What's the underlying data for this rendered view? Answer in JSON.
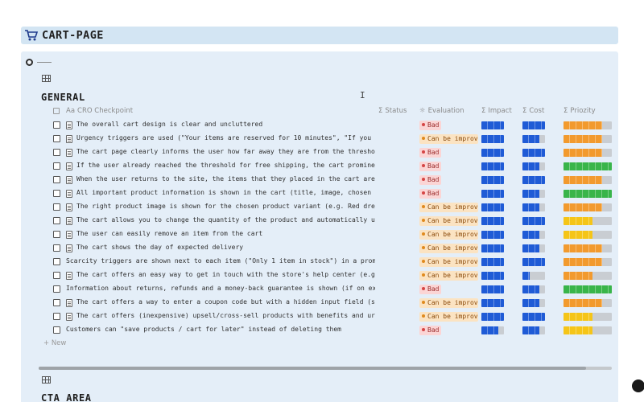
{
  "page": {
    "title": "CART-PAGE",
    "icon": "cart-icon"
  },
  "sections": {
    "general": {
      "title": "GENERAL"
    },
    "cta": {
      "title": "CTA AREA"
    }
  },
  "table": {
    "columns": [
      {
        "key": "checkpoint",
        "symbol": "Aa",
        "label": "CRO Checkpoint"
      },
      {
        "key": "status",
        "symbol": "Σ",
        "label": "Status"
      },
      {
        "key": "evaluation",
        "symbol": "☼",
        "label": "Evaluation"
      },
      {
        "key": "impact",
        "symbol": "Σ",
        "label": "Impact"
      },
      {
        "key": "cost",
        "symbol": "Σ",
        "label": "Cost"
      },
      {
        "key": "priority",
        "symbol": "Σ",
        "label": "Priozity"
      }
    ],
    "new_label": "+ New",
    "rows": [
      {
        "doc": true,
        "text": "The overall cart design is clear and uncluttered",
        "eval": "Bad",
        "impact": 1.0,
        "cost": 1.0,
        "priority": 0.8,
        "priority_color": "#f29a2e"
      },
      {
        "doc": true,
        "text": "Urgency triggers are used (\"Your items are reserved for 10 minutes\", \"If you order in the next",
        "eval": "Can be improved",
        "impact": 1.0,
        "cost": 0.75,
        "priority": 0.8,
        "priority_color": "#f29a2e"
      },
      {
        "doc": true,
        "text": "The cart page clearly informs the user how far away they are from the threshold for free shipping",
        "eval": "Bad",
        "impact": 1.0,
        "cost": 1.0,
        "priority": 0.8,
        "priority_color": "#f29a2e"
      },
      {
        "doc": true,
        "text": "If the user already reached the threshold for free shipping, the cart prominently shows it",
        "eval": "Bad",
        "impact": 1.0,
        "cost": 0.75,
        "priority": 1.0,
        "priority_color": "#39b54a"
      },
      {
        "doc": true,
        "text": "When the user returns to the site, the items that they placed in the cart are still there",
        "eval": "Bad",
        "impact": 1.0,
        "cost": 1.0,
        "priority": 0.8,
        "priority_color": "#f29a2e"
      },
      {
        "doc": true,
        "text": "All important product information is shown in the cart (title, image, chosen variant, price)",
        "eval": "Bad",
        "impact": 1.0,
        "cost": 0.75,
        "priority": 1.0,
        "priority_color": "#39b54a"
      },
      {
        "doc": true,
        "text": "The right product image is shown for the chosen product variant (e.g. Red dress)",
        "eval": "Can be improved",
        "impact": 1.0,
        "cost": 0.75,
        "priority": 0.8,
        "priority_color": "#f29a2e"
      },
      {
        "doc": true,
        "text": "The cart allows you to change the quantity of the product and automatically updates the total",
        "eval": "Can be improved",
        "impact": 1.0,
        "cost": 1.0,
        "priority": 0.6,
        "priority_color": "#f5c518"
      },
      {
        "doc": true,
        "text": "The user can easily remove an item from the cart",
        "eval": "Can be improved",
        "impact": 1.0,
        "cost": 0.75,
        "priority": 0.6,
        "priority_color": "#f5c518"
      },
      {
        "doc": true,
        "text": "The cart shows the day of expected delivery",
        "eval": "Can be improved",
        "impact": 1.0,
        "cost": 0.75,
        "priority": 0.8,
        "priority_color": "#f29a2e"
      },
      {
        "doc": false,
        "text": "Scarcity triggers are shown next to each item (\"Only 1 item in stock\") in a prominent way",
        "eval": "Can be improved",
        "impact": 1.0,
        "cost": 1.0,
        "priority": 0.8,
        "priority_color": "#f29a2e"
      },
      {
        "doc": true,
        "text": "The cart offers an easy way to get in touch with the store's help center (e.g. live chat)",
        "eval": "Can be improved",
        "impact": 1.0,
        "cost": 0.33,
        "priority": 0.6,
        "priority_color": "#f29a2e"
      },
      {
        "doc": false,
        "text": "Information about returns, refunds and a money-back guarantee is shown (if on extra page)",
        "eval": "Bad",
        "impact": 1.0,
        "cost": 0.75,
        "priority": 1.0,
        "priority_color": "#39b54a"
      },
      {
        "doc": true,
        "text": "The cart offers a way to enter a coupon code but with a hidden input field (so it doesn't distract)",
        "eval": "Can be improved",
        "impact": 1.0,
        "cost": 0.75,
        "priority": 0.8,
        "priority_color": "#f29a2e"
      },
      {
        "doc": true,
        "text": "The cart offers (inexpensive) upsell/cross-sell products with benefits and urgency",
        "eval": "Can be improved",
        "impact": 1.0,
        "cost": 1.0,
        "priority": 0.6,
        "priority_color": "#f5c518"
      },
      {
        "doc": false,
        "text": "Customers can \"save products / cart for later\" instead of deleting them",
        "eval": "Bad",
        "impact": 0.75,
        "cost": 0.75,
        "priority": 0.6,
        "priority_color": "#f5c518"
      }
    ]
  },
  "colors": {
    "header_bg": "#d3e5f3",
    "panel_bg": "#e4eef8",
    "bar_blue": "#1f5bd6",
    "bar_empty": "#c9cdd2",
    "bad_bg": "#fbd5d5",
    "improve_bg": "#fbe3c2"
  }
}
